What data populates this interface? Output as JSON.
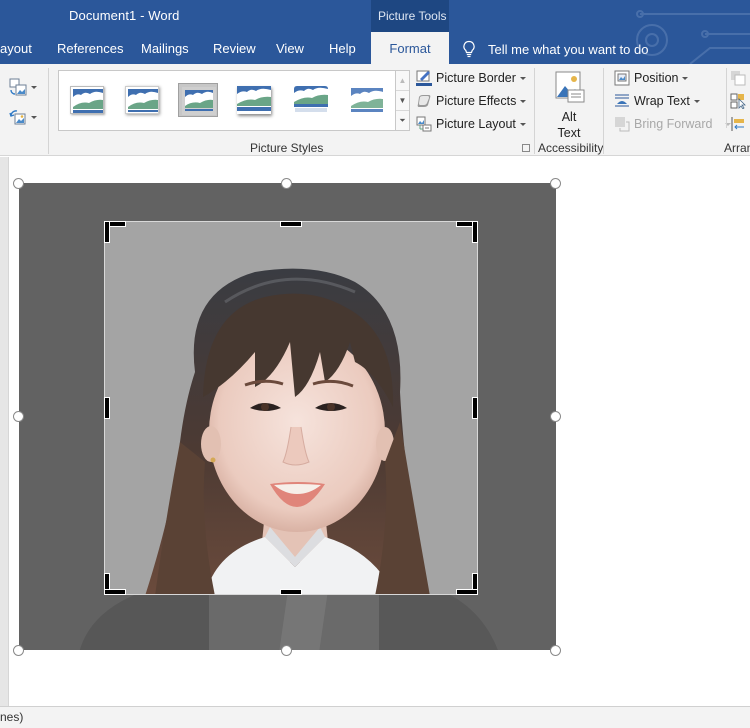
{
  "window": {
    "title": "Document1  -  Word"
  },
  "contextual_group": "Picture Tools",
  "tabs": [
    {
      "label": "ayout"
    },
    {
      "label": "References"
    },
    {
      "label": "Mailings"
    },
    {
      "label": "Review"
    },
    {
      "label": "View"
    },
    {
      "label": "Help"
    },
    {
      "label": "Format",
      "active": true
    }
  ],
  "tell_me": {
    "placeholder": "Tell me what you want to do"
  },
  "ribbon": {
    "adjust_buttons": [
      {
        "icon": "change-picture-icon"
      },
      {
        "icon": "reset-picture-icon"
      }
    ],
    "picture_styles": {
      "label": "Picture Styles",
      "selected_index": 2,
      "thumbs": [
        "Simple Frame, White",
        "Beveled Matte, White",
        "Metal Frame",
        "Drop Shadow Rectangle",
        "Reflected Rounded Rectangle",
        "Soft Edge Rectangle"
      ],
      "commands": [
        {
          "label": "Picture Border",
          "icon": "picture-border-icon"
        },
        {
          "label": "Picture Effects",
          "icon": "picture-effects-icon"
        },
        {
          "label": "Picture Layout",
          "icon": "picture-layout-icon"
        }
      ]
    },
    "accessibility": {
      "label": "Accessibility",
      "alt_text": [
        "Alt",
        "Text"
      ]
    },
    "arrange": {
      "label": "Arran",
      "commands": [
        {
          "label": "Position",
          "icon": "position-icon",
          "enabled": true
        },
        {
          "label": "Wrap Text",
          "icon": "wrap-text-icon",
          "enabled": true
        },
        {
          "label": "Bring Forward",
          "icon": "bring-forward-icon",
          "enabled": false
        }
      ]
    }
  },
  "colors": {
    "accent": "#2b579a",
    "contextual": "#1e4782",
    "ribbon_bg": "#f3f3f3",
    "crop_outside": "#626262",
    "crop_inside_bg": "#a3a3a3"
  },
  "document": {
    "picture": {
      "description": "Portrait photo of a smiling young woman with long dark hair and bangs, wearing a white top, in crop mode"
    }
  },
  "status_bar": {
    "text": "nes)"
  }
}
